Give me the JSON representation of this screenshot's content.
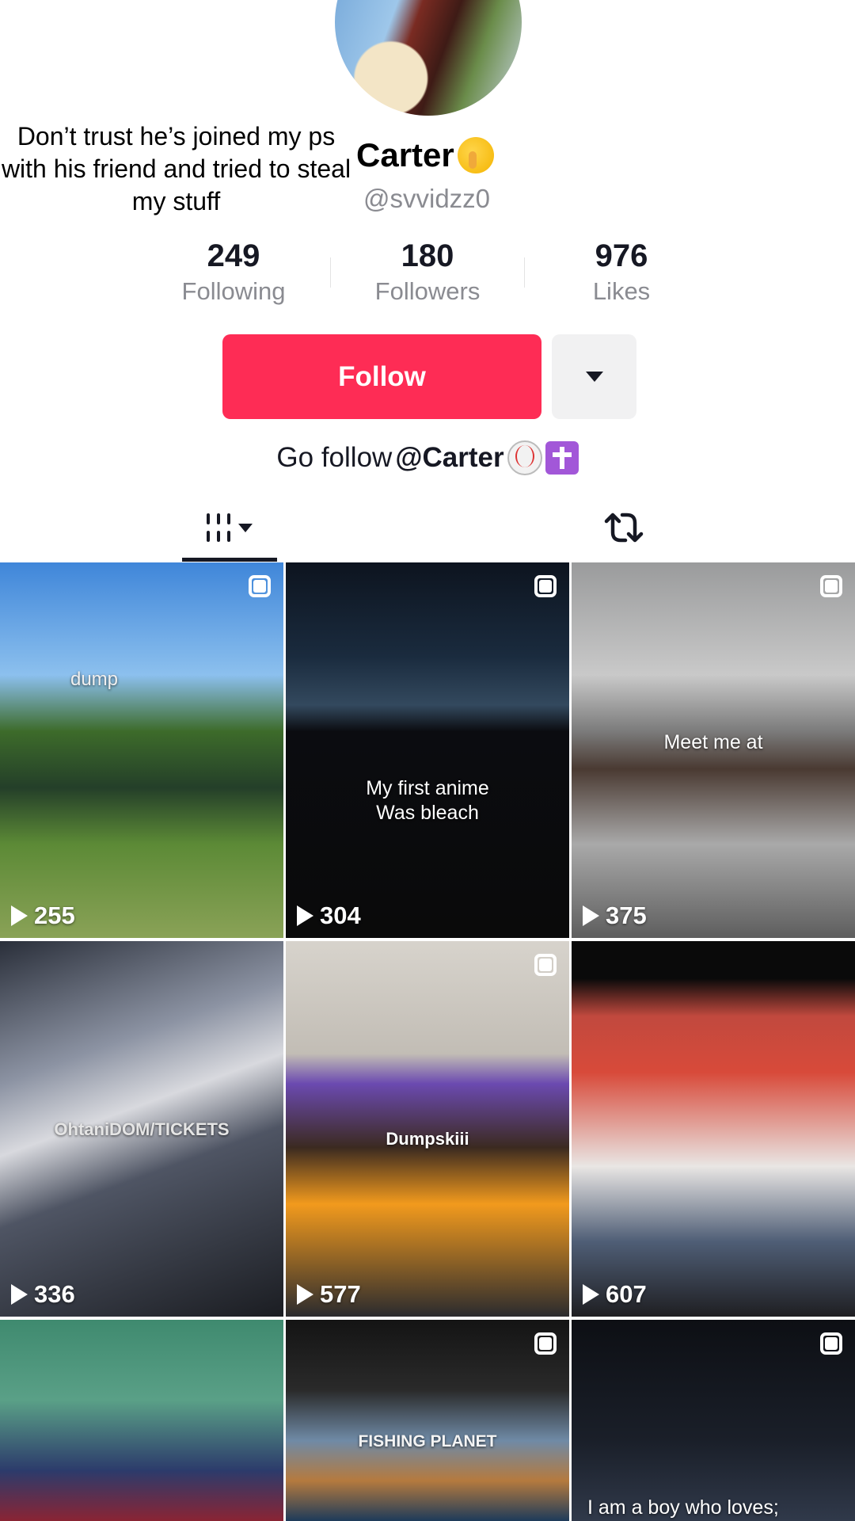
{
  "profile": {
    "caption": "Don’t trust he’s joined my ps with his friend and tried to steal my stuff",
    "name": "Carter",
    "handle": "@svvidzz0",
    "bio_prefix": "Go follow",
    "bio_mention": "@Carter"
  },
  "stats": [
    {
      "value": "249",
      "label": "Following"
    },
    {
      "value": "180",
      "label": "Followers"
    },
    {
      "value": "976",
      "label": "Likes"
    }
  ],
  "actions": {
    "follow_label": "Follow"
  },
  "tabs": {
    "videos_icon": "grid-icon",
    "reposts_icon": "repost-icon"
  },
  "videos": [
    {
      "views": "255",
      "text": "dump",
      "icon": "multi-photo-icon"
    },
    {
      "views": "304",
      "text": "My first anime\nWas bleach",
      "icon": "multi-photo-icon"
    },
    {
      "views": "375",
      "text": "Meet me at",
      "icon": "multi-photo-icon"
    },
    {
      "views": "336",
      "text": "OhtaniDOM/TICKETS",
      "icon": ""
    },
    {
      "views": "577",
      "text": "Dumpskiii",
      "icon": "multi-photo-icon"
    },
    {
      "views": "607",
      "text": "",
      "icon": ""
    },
    {
      "views": "",
      "text": "",
      "icon": ""
    },
    {
      "views": "",
      "text": "FISHING PLANET",
      "icon": "multi-photo-icon"
    },
    {
      "views": "",
      "text": "I am a boy who loves;",
      "icon": "multi-photo-icon"
    }
  ],
  "colors": {
    "accent": "#fe2c55",
    "secondary_button": "#f1f1f2",
    "muted_text": "#8a8b91"
  }
}
